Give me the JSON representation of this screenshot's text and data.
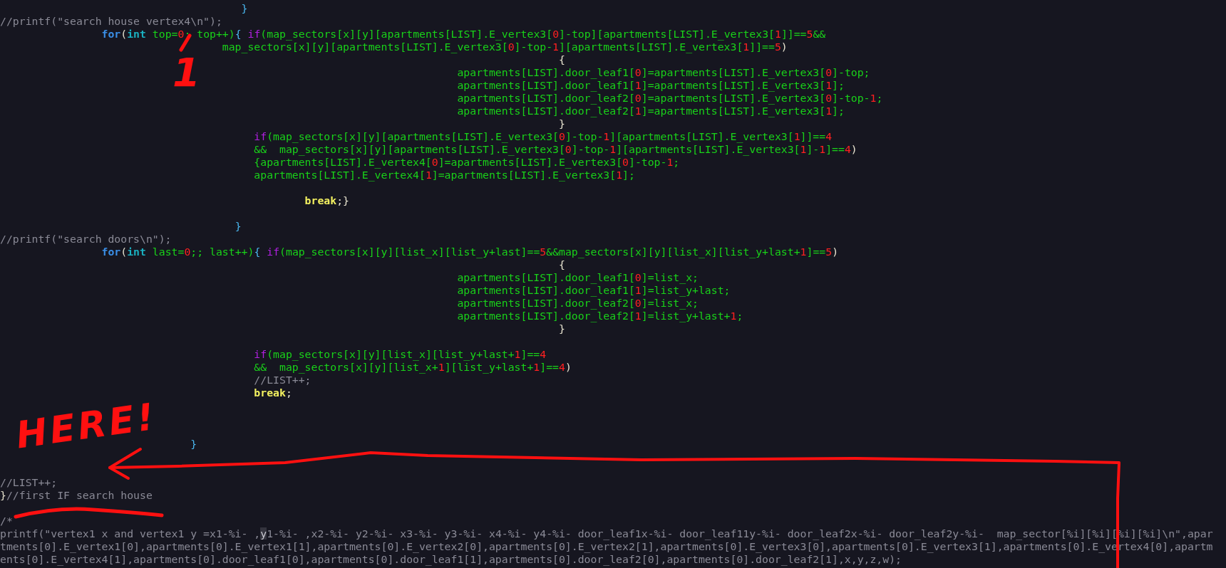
{
  "editor": {
    "lines": [
      {
        "kind": "code",
        "segments": [
          {
            "kind": "brace",
            "text": "                                      }"
          }
        ]
      },
      {
        "kind": "code",
        "segments": [
          {
            "kind": "comment",
            "text": "//printf(\"search house vertex4\\n\");"
          }
        ]
      },
      {
        "kind": "code",
        "segments": [
          {
            "kind": "for",
            "text": "                for"
          },
          {
            "kind": "punct",
            "text": "("
          },
          {
            "kind": "type",
            "text": "int"
          },
          {
            "kind": "id",
            "text": " top="
          },
          {
            "kind": "num",
            "text": "0"
          },
          {
            "kind": "id",
            "text": "; top++)"
          },
          {
            "kind": "brace",
            "text": "{ "
          },
          {
            "kind": "if",
            "text": "if"
          },
          {
            "kind": "id",
            "text": "(map_sectors[x][y][apartments[LIST].E_vertex3["
          },
          {
            "kind": "num",
            "text": "0"
          },
          {
            "kind": "id",
            "text": "]-top][apartments[LIST].E_vertex3["
          },
          {
            "kind": "num",
            "text": "1"
          },
          {
            "kind": "id",
            "text": "]]=="
          },
          {
            "kind": "num",
            "text": "5"
          },
          {
            "kind": "id",
            "text": "&&"
          }
        ]
      },
      {
        "kind": "code",
        "segments": [
          {
            "kind": "id",
            "text": "                                   map_sectors[x][y][apartments[LIST].E_vertex3["
          },
          {
            "kind": "num",
            "text": "0"
          },
          {
            "kind": "id",
            "text": "]-top-"
          },
          {
            "kind": "num",
            "text": "1"
          },
          {
            "kind": "id",
            "text": "][apartments[LIST].E_vertex3["
          },
          {
            "kind": "num",
            "text": "1"
          },
          {
            "kind": "id",
            "text": "]]=="
          },
          {
            "kind": "num",
            "text": "5"
          },
          {
            "kind": "punct",
            "text": ")"
          }
        ]
      },
      {
        "kind": "code",
        "segments": [
          {
            "kind": "punct",
            "text": "                                                                                        {"
          }
        ]
      },
      {
        "kind": "code",
        "segments": [
          {
            "kind": "id",
            "text": "                                                                        apartments[LIST].door_leaf1["
          },
          {
            "kind": "num",
            "text": "0"
          },
          {
            "kind": "id",
            "text": "]=apartments[LIST].E_vertex3["
          },
          {
            "kind": "num",
            "text": "0"
          },
          {
            "kind": "id",
            "text": "]-top;"
          }
        ]
      },
      {
        "kind": "code",
        "segments": [
          {
            "kind": "id",
            "text": "                                                                        apartments[LIST].door_leaf1["
          },
          {
            "kind": "num",
            "text": "1"
          },
          {
            "kind": "id",
            "text": "]=apartments[LIST].E_vertex3["
          },
          {
            "kind": "num",
            "text": "1"
          },
          {
            "kind": "id",
            "text": "];"
          }
        ]
      },
      {
        "kind": "code",
        "segments": [
          {
            "kind": "id",
            "text": "                                                                        apartments[LIST].door_leaf2["
          },
          {
            "kind": "num",
            "text": "0"
          },
          {
            "kind": "id",
            "text": "]=apartments[LIST].E_vertex3["
          },
          {
            "kind": "num",
            "text": "0"
          },
          {
            "kind": "id",
            "text": "]-top-"
          },
          {
            "kind": "num",
            "text": "1"
          },
          {
            "kind": "id",
            "text": ";"
          }
        ]
      },
      {
        "kind": "code",
        "segments": [
          {
            "kind": "id",
            "text": "                                                                        apartments[LIST].door_leaf2["
          },
          {
            "kind": "num",
            "text": "1"
          },
          {
            "kind": "id",
            "text": "]=apartments[LIST].E_vertex3["
          },
          {
            "kind": "num",
            "text": "1"
          },
          {
            "kind": "id",
            "text": "];"
          }
        ]
      },
      {
        "kind": "code",
        "segments": [
          {
            "kind": "punct",
            "text": "                                                                                        }"
          }
        ]
      },
      {
        "kind": "code",
        "segments": [
          {
            "kind": "if",
            "text": "                                        if"
          },
          {
            "kind": "id",
            "text": "(map_sectors[x][y][apartments[LIST].E_vertex3["
          },
          {
            "kind": "num",
            "text": "0"
          },
          {
            "kind": "id",
            "text": "]-top-"
          },
          {
            "kind": "num",
            "text": "1"
          },
          {
            "kind": "id",
            "text": "][apartments[LIST].E_vertex3["
          },
          {
            "kind": "num",
            "text": "1"
          },
          {
            "kind": "id",
            "text": "]]=="
          },
          {
            "kind": "num",
            "text": "4"
          }
        ]
      },
      {
        "kind": "code",
        "segments": [
          {
            "kind": "id",
            "text": "                                        &&  map_sectors[x][y][apartments[LIST].E_vertex3["
          },
          {
            "kind": "num",
            "text": "0"
          },
          {
            "kind": "id",
            "text": "]-top-"
          },
          {
            "kind": "num",
            "text": "1"
          },
          {
            "kind": "id",
            "text": "][apartments[LIST].E_vertex3["
          },
          {
            "kind": "num",
            "text": "1"
          },
          {
            "kind": "id",
            "text": "]-"
          },
          {
            "kind": "num",
            "text": "1"
          },
          {
            "kind": "id",
            "text": "]=="
          },
          {
            "kind": "num",
            "text": "4"
          },
          {
            "kind": "punct",
            "text": ")"
          }
        ]
      },
      {
        "kind": "code",
        "segments": [
          {
            "kind": "id",
            "text": "                                        {apartments[LIST].E_vertex4["
          },
          {
            "kind": "num",
            "text": "0"
          },
          {
            "kind": "id",
            "text": "]=apartments[LIST].E_vertex3["
          },
          {
            "kind": "num",
            "text": "0"
          },
          {
            "kind": "id",
            "text": "]-top-"
          },
          {
            "kind": "num",
            "text": "1"
          },
          {
            "kind": "id",
            "text": ";"
          }
        ]
      },
      {
        "kind": "code",
        "segments": [
          {
            "kind": "id",
            "text": "                                        apartments[LIST].E_vertex4["
          },
          {
            "kind": "num",
            "text": "1"
          },
          {
            "kind": "id",
            "text": "]=apartments[LIST].E_vertex3["
          },
          {
            "kind": "num",
            "text": "1"
          },
          {
            "kind": "id",
            "text": "];"
          }
        ]
      },
      {
        "kind": "blank"
      },
      {
        "kind": "code",
        "segments": [
          {
            "kind": "break",
            "text": "                                                break"
          },
          {
            "kind": "punct",
            "text": ";}"
          }
        ]
      },
      {
        "kind": "blank"
      },
      {
        "kind": "code",
        "segments": [
          {
            "kind": "brace",
            "text": "                                     }"
          }
        ]
      },
      {
        "kind": "code",
        "segments": [
          {
            "kind": "comment",
            "text": "//printf(\"search doors\\n\");"
          }
        ]
      },
      {
        "kind": "code",
        "segments": [
          {
            "kind": "for",
            "text": "                for"
          },
          {
            "kind": "punct",
            "text": "("
          },
          {
            "kind": "type",
            "text": "int"
          },
          {
            "kind": "id",
            "text": " last="
          },
          {
            "kind": "num",
            "text": "0"
          },
          {
            "kind": "id",
            "text": ";; last++)"
          },
          {
            "kind": "brace",
            "text": "{ "
          },
          {
            "kind": "if",
            "text": "if"
          },
          {
            "kind": "id",
            "text": "(map_sectors[x][y][list_x][list_y+last]=="
          },
          {
            "kind": "num",
            "text": "5"
          },
          {
            "kind": "id",
            "text": "&&map_sectors[x][y][list_x][list_y+last+"
          },
          {
            "kind": "num",
            "text": "1"
          },
          {
            "kind": "id",
            "text": "]=="
          },
          {
            "kind": "num",
            "text": "5"
          },
          {
            "kind": "punct",
            "text": ")"
          }
        ]
      },
      {
        "kind": "code",
        "segments": [
          {
            "kind": "punct",
            "text": "                                                                                        {"
          }
        ]
      },
      {
        "kind": "code",
        "segments": [
          {
            "kind": "id",
            "text": "                                                                        apartments[LIST].door_leaf1["
          },
          {
            "kind": "num",
            "text": "0"
          },
          {
            "kind": "id",
            "text": "]=list_x;"
          }
        ]
      },
      {
        "kind": "code",
        "segments": [
          {
            "kind": "id",
            "text": "                                                                        apartments[LIST].door_leaf1["
          },
          {
            "kind": "num",
            "text": "1"
          },
          {
            "kind": "id",
            "text": "]=list_y+last;"
          }
        ]
      },
      {
        "kind": "code",
        "segments": [
          {
            "kind": "id",
            "text": "                                                                        apartments[LIST].door_leaf2["
          },
          {
            "kind": "num",
            "text": "0"
          },
          {
            "kind": "id",
            "text": "]=list_x;"
          }
        ]
      },
      {
        "kind": "code",
        "segments": [
          {
            "kind": "id",
            "text": "                                                                        apartments[LIST].door_leaf2["
          },
          {
            "kind": "num",
            "text": "1"
          },
          {
            "kind": "id",
            "text": "]=list_y+last+"
          },
          {
            "kind": "num",
            "text": "1"
          },
          {
            "kind": "id",
            "text": ";"
          }
        ]
      },
      {
        "kind": "code",
        "segments": [
          {
            "kind": "punct",
            "text": "                                                                                        }"
          }
        ]
      },
      {
        "kind": "blank"
      },
      {
        "kind": "code",
        "segments": [
          {
            "kind": "if",
            "text": "                                        if"
          },
          {
            "kind": "id",
            "text": "(map_sectors[x][y][list_x][list_y+last+"
          },
          {
            "kind": "num",
            "text": "1"
          },
          {
            "kind": "id",
            "text": "]=="
          },
          {
            "kind": "num",
            "text": "4"
          }
        ]
      },
      {
        "kind": "code",
        "segments": [
          {
            "kind": "id",
            "text": "                                        &&  map_sectors[x][y][list_x+"
          },
          {
            "kind": "num",
            "text": "1"
          },
          {
            "kind": "id",
            "text": "][list_y+last+"
          },
          {
            "kind": "num",
            "text": "1"
          },
          {
            "kind": "id",
            "text": "]=="
          },
          {
            "kind": "num",
            "text": "4"
          },
          {
            "kind": "punct",
            "text": ")"
          }
        ]
      },
      {
        "kind": "code",
        "segments": [
          {
            "kind": "comment",
            "text": "                                        //LIST++;"
          }
        ]
      },
      {
        "kind": "code",
        "segments": [
          {
            "kind": "break",
            "text": "                                        break"
          },
          {
            "kind": "punct",
            "text": ";"
          }
        ]
      },
      {
        "kind": "blank"
      },
      {
        "kind": "blank"
      },
      {
        "kind": "blank"
      },
      {
        "kind": "code",
        "segments": [
          {
            "kind": "brace",
            "text": "                              }"
          }
        ]
      },
      {
        "kind": "blank"
      },
      {
        "kind": "blank"
      },
      {
        "kind": "code",
        "segments": [
          {
            "kind": "comment",
            "text": "//LIST++;"
          }
        ]
      },
      {
        "kind": "code",
        "segments": [
          {
            "kind": "punct",
            "text": "}"
          },
          {
            "kind": "comment",
            "text": "//first IF search house"
          }
        ]
      },
      {
        "kind": "blank"
      },
      {
        "kind": "code",
        "segments": [
          {
            "kind": "comment",
            "text": "/*"
          }
        ]
      },
      {
        "kind": "code",
        "segments": [
          {
            "kind": "comment",
            "text": "printf(\"vertex1 x and vertex1 y =x1-%i- ,"
          },
          {
            "kind": "cursor",
            "text": "y"
          },
          {
            "kind": "comment",
            "text": "1-%i- ,x2-%i- y2-%i- x3-%i- y3-%i- x4-%i- y4-%i- door_leaf1x-%i- door_leaf11y-%i- door_leaf2x-%i- door_leaf2y-%i-  map_sector[%i][%i][%i][%i]\\n\",apar"
          }
        ]
      },
      {
        "kind": "code",
        "segments": [
          {
            "kind": "comment",
            "text": "tments[0].E_vertex1[0],apartments[0].E_vertex1[1],apartments[0].E_vertex2[0],apartments[0].E_vertex2[1],apartments[0].E_vertex3[0],apartments[0].E_vertex3[1],apartments[0].E_vertex4[0],apartm"
          }
        ]
      },
      {
        "kind": "code",
        "segments": [
          {
            "kind": "comment",
            "text": "ents[0].E_vertex4[1],apartments[0].door_leaf1[0],apartments[0].door_leaf1[1],apartments[0].door_leaf2[0],apartments[0].door_leaf2[1],x,y,z,w);"
          }
        ]
      }
    ]
  },
  "annotations": [
    {
      "kind": "number",
      "text": "1"
    },
    {
      "kind": "label",
      "text": "HERE!"
    }
  ]
}
